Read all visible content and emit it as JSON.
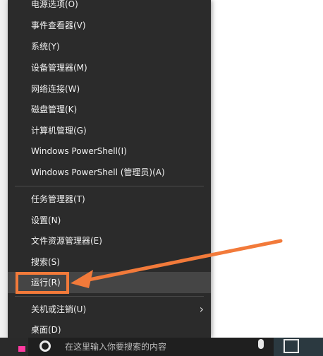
{
  "menu": {
    "items": [
      {
        "label": "电源选项(O)"
      },
      {
        "label": "事件查看器(V)"
      },
      {
        "label": "系统(Y)"
      },
      {
        "label": "设备管理器(M)"
      },
      {
        "label": "网络连接(W)"
      },
      {
        "label": "磁盘管理(K)"
      },
      {
        "label": "计算机管理(G)"
      },
      {
        "label": "Windows PowerShell(I)"
      },
      {
        "label": "Windows PowerShell (管理员)(A)"
      },
      {
        "label": "任务管理器(T)"
      },
      {
        "label": "设置(N)"
      },
      {
        "label": "文件资源管理器(E)"
      },
      {
        "label": "搜索(S)"
      },
      {
        "label": "运行(R)"
      },
      {
        "label": "关机或注销(U)"
      },
      {
        "label": "桌面(D)"
      }
    ],
    "submenu_chevron": "›"
  },
  "taskbar": {
    "search_text": "在这里输入你要搜索的内容"
  },
  "colors": {
    "menu_bg": "#2b2b2b",
    "hover_bg": "#454545",
    "highlight_orange": "#f27a3a"
  }
}
